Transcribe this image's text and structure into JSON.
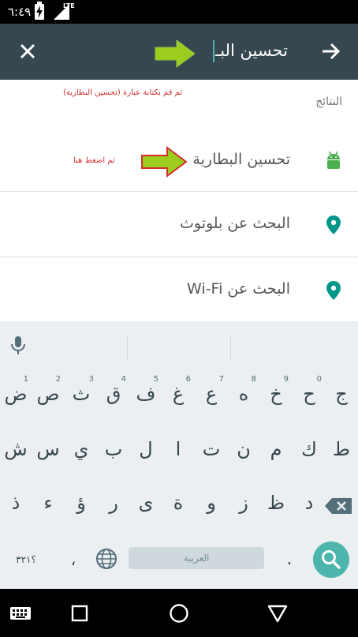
{
  "status_bar": {
    "time": "٦:٤٩",
    "network": "LTE",
    "icons": [
      "battery-charging-icon",
      "signal-icon"
    ]
  },
  "toolbar": {
    "search_text": "تحسين البـ",
    "icons": [
      "close-icon",
      "arrow-right-icon"
    ],
    "accent_color": "#4db6ac",
    "background": "#37474f"
  },
  "results": {
    "header": "النتائج",
    "annotation_top": "ثم قم بكتابة عبارة (تحسين البطارية)",
    "annotation_here": "ثم اضغط هنا",
    "items": [
      {
        "label": "تحسين البطارية",
        "icon": "android-icon"
      },
      {
        "label": "البحث عن بلوتوث",
        "icon": "location-pin-icon"
      },
      {
        "label": "البحث عن Wi-Fi",
        "icon": "location-pin-icon"
      }
    ]
  },
  "annotation_colors": {
    "arrow_fill": "#9ccc1e",
    "arrow_stroke": "#d32f2f",
    "text": "#d32f2f"
  },
  "keyboard": {
    "row1": [
      {
        "char": "ض",
        "hint": "1"
      },
      {
        "char": "ص",
        "hint": "2"
      },
      {
        "char": "ث",
        "hint": "3"
      },
      {
        "char": "ق",
        "hint": "4"
      },
      {
        "char": "ف",
        "hint": "5"
      },
      {
        "char": "غ",
        "hint": "6"
      },
      {
        "char": "ع",
        "hint": "7"
      },
      {
        "char": "ه",
        "hint": "8"
      },
      {
        "char": "خ",
        "hint": "9"
      },
      {
        "char": "ح",
        "hint": "0"
      },
      {
        "char": "ج",
        "hint": ""
      }
    ],
    "row2": [
      "ش",
      "س",
      "ي",
      "ب",
      "ل",
      "ا",
      "ت",
      "ن",
      "م",
      "ك",
      "ط"
    ],
    "row3": [
      "ذ",
      "ء",
      "ؤ",
      "ر",
      "ى",
      "ة",
      "و",
      "ز",
      "ظ",
      "د"
    ],
    "symbols_label": "؟٣٢١",
    "comma": "،",
    "space_label": "العربية",
    "period": ".",
    "icons": [
      "microphone-icon",
      "backspace-icon",
      "globe-icon",
      "search-icon"
    ]
  },
  "navbar": {
    "icons": [
      "keyboard-icon",
      "recents-icon",
      "home-icon",
      "back-icon"
    ]
  }
}
